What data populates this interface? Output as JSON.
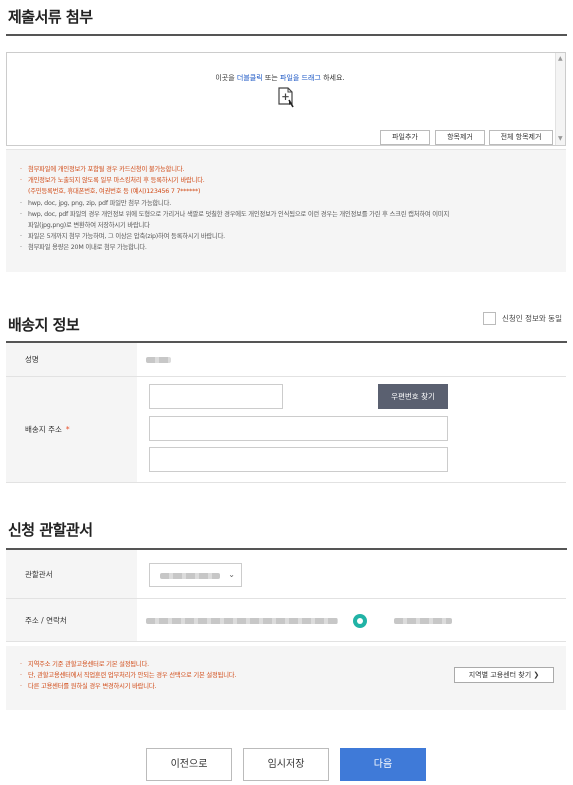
{
  "attachments": {
    "title": "제출서류 첨부",
    "hint_prefix": "이곳을 ",
    "hint_dblclick": "더블클릭",
    "hint_mid": " 또는 ",
    "hint_drag": "파일을 드래그",
    "hint_suffix": " 하세요.",
    "buttons": {
      "add": "파일추가",
      "remove": "항목제거",
      "remove_all": "전체 항목제거"
    },
    "notices": [
      "첨부파일에 개인정보가 포함될 경우 카드신청이 불가능합니다.",
      "개인정보가 노출되지 않도록 일부 마스킹처리 후 등록하시기 바랍니다.",
      "(주민등록번호, 휴대폰번호, 여권번호 등 (예시)123456 7 7******)",
      "hwp, doc, jpg, png, zip, pdf 파일만 첨부 가능합니다.",
      "hwp, doc, pdf 파일의 경우 개인정보 위에 도형으로 가리거나 색깔로 덧칠한 경우에도 개인정보가 인식됨으로 이런 경우는 개인정보를 가린 후 스크린 캡처하여 이미지",
      "파일(jpg,png)로 변환하여 저장하시기 바랍니다",
      "파일은 5개까지 첨부 가능하며, 그 이상은 압축(zip)하여 등록하시기 바랍니다.",
      "첨부파일 용량은 20M 이내로 첨부 가능합니다."
    ]
  },
  "shipping": {
    "title": "배송지 정보",
    "same_as_applicant": "신청인 정보와 동일",
    "name_label": "성명",
    "address_label": "배송지 주소",
    "required_mark": "*",
    "zip_button": "우편번호 찾기"
  },
  "office": {
    "title": "신청 관할관서",
    "office_label": "관할관서",
    "contact_label": "주소 / 연락처",
    "notices": [
      "지역주소 기준 관할고용센터로 기본 설정됩니다.",
      "단, 관할고용센터에서 직업훈련 업무처리가 안되는 경우 선택으로 기본 설정됩니다.",
      "다른 고용센터를 원하실 경우 변경하시기 바랍니다."
    ],
    "region_button": "지역별 고용센터 찾기 ❯"
  },
  "footer": {
    "prev": "이전으로",
    "temp_save": "임시저장",
    "next": "다음"
  },
  "colors": {
    "accent": "#3f7ad8",
    "notice_red": "#d14a16",
    "pin": "#21b3a6",
    "dark_button": "#5a6070"
  }
}
